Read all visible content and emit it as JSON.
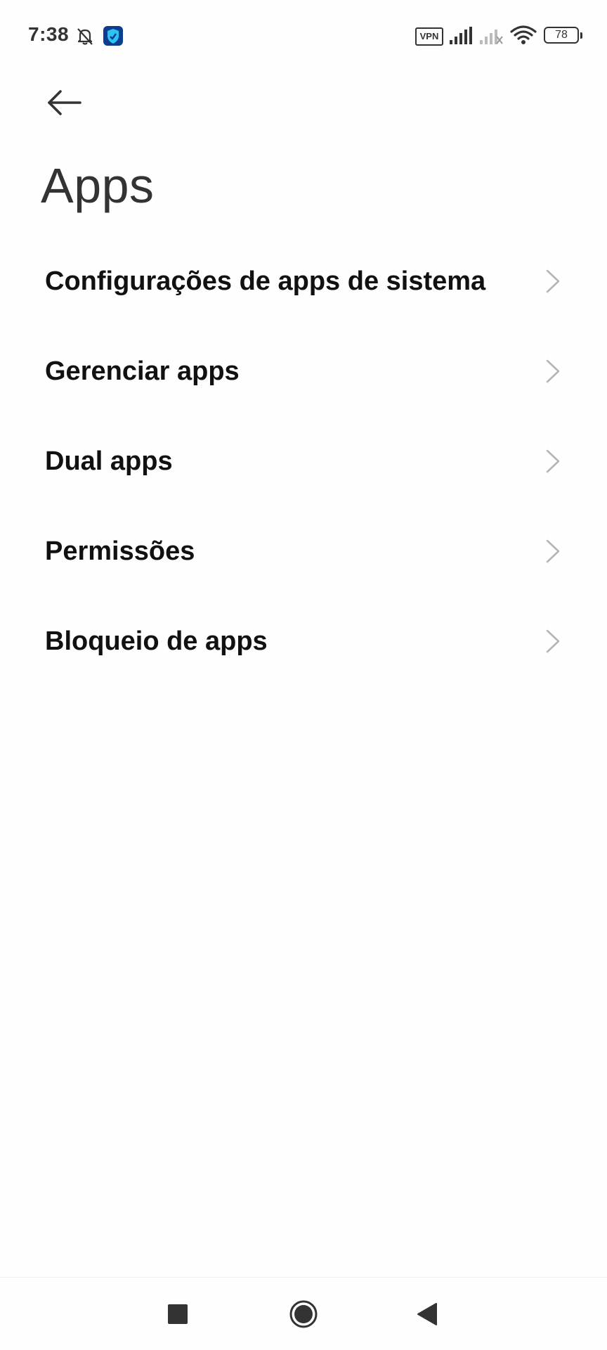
{
  "status_bar": {
    "time": "7:38",
    "vpn_label": "VPN",
    "battery_level": "78",
    "icons": [
      "bell-off-icon",
      "shield-icon",
      "signal-icon",
      "signal-no-service-icon",
      "wifi-icon",
      "battery-icon"
    ]
  },
  "header": {
    "back_icon": "arrow-left-icon",
    "title": "Apps"
  },
  "list": {
    "items": [
      {
        "label": "Configurações de apps de sistema"
      },
      {
        "label": "Gerenciar apps"
      },
      {
        "label": "Dual apps"
      },
      {
        "label": "Permissões"
      },
      {
        "label": "Bloqueio de apps"
      }
    ],
    "chevron_icon": "chevron-right-icon"
  },
  "nav_bar": {
    "icons": [
      "square-recents-icon",
      "circle-home-icon",
      "triangle-back-icon"
    ]
  },
  "colors": {
    "background": "#fefefe",
    "text_primary": "#111111",
    "text_secondary": "#333333",
    "chevron": "#b5b5b5"
  }
}
